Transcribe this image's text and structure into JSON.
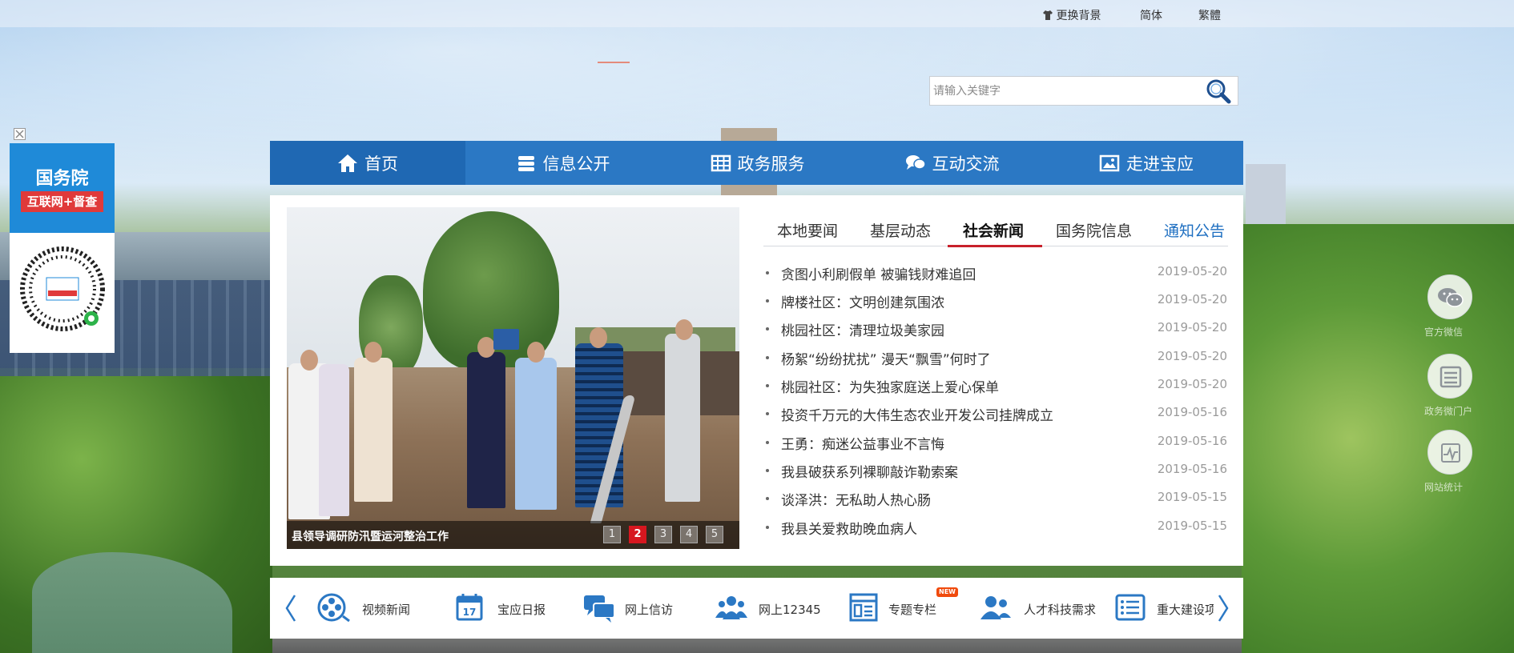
{
  "topbar": {
    "change_bg": "更换背景",
    "simplified": "简体",
    "traditional": "繁體"
  },
  "search": {
    "placeholder": "请输入关键字"
  },
  "float_ad": {
    "title": "国务院",
    "subtitle": "互联网+督查"
  },
  "nav": [
    {
      "label": "首页",
      "icon": "home-icon"
    },
    {
      "label": "信息公开",
      "icon": "database-icon"
    },
    {
      "label": "政务服务",
      "icon": "grid-icon"
    },
    {
      "label": "互动交流",
      "icon": "chat-icon"
    },
    {
      "label": "走进宝应",
      "icon": "image-icon"
    }
  ],
  "slideshow": {
    "caption": "县领导调研防汛暨运河整治工作",
    "pages": [
      "1",
      "2",
      "3",
      "4",
      "5"
    ],
    "active_page": "2"
  },
  "tabs": [
    {
      "label": "本地要闻"
    },
    {
      "label": "基层动态"
    },
    {
      "label": "社会新闻"
    },
    {
      "label": "国务院信息"
    },
    {
      "label": "通知公告"
    }
  ],
  "active_tab": "社会新闻",
  "news": [
    {
      "title": "贪图小利刷假单 被骗钱财难追回",
      "date": "2019-05-20"
    },
    {
      "title": "牌楼社区：文明创建氛围浓",
      "date": "2019-05-20"
    },
    {
      "title": "桃园社区：清理垃圾美家园",
      "date": "2019-05-20"
    },
    {
      "title": "杨絮“纷纷扰扰” 漫天“飘雪”何时了",
      "date": "2019-05-20"
    },
    {
      "title": "桃园社区：为失独家庭送上爱心保单",
      "date": "2019-05-20"
    },
    {
      "title": "投资千万元的大伟生态农业开发公司挂牌成立",
      "date": "2019-05-16"
    },
    {
      "title": "王勇：痴迷公益事业不言悔",
      "date": "2019-05-16"
    },
    {
      "title": "我县破获系列裸聊敲诈勒索案",
      "date": "2019-05-16"
    },
    {
      "title": "谈泽洪：无私助人热心肠",
      "date": "2019-05-15"
    },
    {
      "title": "我县关爱救助晚血病人",
      "date": "2019-05-15"
    }
  ],
  "shortcuts": [
    {
      "label": "视频新闻",
      "icon": "film-reel-icon"
    },
    {
      "label": "宝应日报",
      "icon": "calendar-icon"
    },
    {
      "label": "网上信访",
      "icon": "speech-bubbles-icon"
    },
    {
      "label": "网上12345",
      "icon": "people-icon"
    },
    {
      "label": "专题专栏",
      "icon": "layout-icon",
      "badge": "NEW"
    },
    {
      "label": "人才科技需求",
      "icon": "person-add-icon"
    },
    {
      "label": "重大建设项",
      "icon": "list-icon"
    }
  ],
  "right_float": {
    "wechat_label": "官方微信",
    "list_label": "政务微门户",
    "chart_label": "网站统计"
  },
  "colors": {
    "nav_blue": "#2b78c4",
    "nav_active": "#1f68b3",
    "tab_active_underline": "#c8202a",
    "link_blue": "#1e6fc1",
    "pagination_active": "#d7171f"
  }
}
